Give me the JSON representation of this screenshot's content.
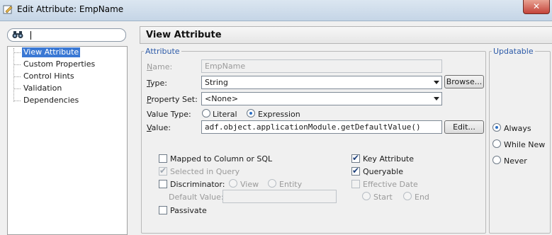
{
  "window": {
    "title": "Edit Attribute: EmpName",
    "close_glyph": "✕"
  },
  "nav": {
    "search_placeholder": "",
    "items": [
      {
        "label": "View Attribute",
        "selected": true
      },
      {
        "label": "Custom Properties"
      },
      {
        "label": "Control Hints"
      },
      {
        "label": "Validation"
      },
      {
        "label": "Dependencies"
      }
    ]
  },
  "main": {
    "title": "View Attribute"
  },
  "attribute": {
    "legend": "Attribute",
    "name_label": "Name:",
    "name_value": "EmpName",
    "type_label": "Type:",
    "type_value": "String",
    "browse_label": "Browse...",
    "property_set_label": "Property Set:",
    "property_set_value": "<None>",
    "value_type_label": "Value Type:",
    "value_type_options": {
      "literal": "Literal",
      "expression": "Expression",
      "selected": "Expression"
    },
    "value_label": "Value:",
    "value_value": "adf.object.applicationModule.getDefaultValue()",
    "edit_label": "Edit...",
    "mapped_label": "Mapped to Column or SQL",
    "mapped_checked": false,
    "selected_in_query_label": "Selected in Query",
    "selected_in_query_checked": true,
    "discriminator_label": "Discriminator:",
    "discriminator_checked": false,
    "discriminator_options": {
      "view": "View",
      "entity": "Entity"
    },
    "default_value_label": "Default Value:",
    "default_value_value": "",
    "passivate_label": "Passivate",
    "passivate_checked": false,
    "key_attribute_label": "Key Attribute",
    "key_attribute_checked": true,
    "queryable_label": "Queryable",
    "queryable_checked": true,
    "effective_date_label": "Effective Date",
    "effective_date_checked": false,
    "effective_options": {
      "start": "Start",
      "end": "End"
    }
  },
  "updatable": {
    "legend": "Updatable",
    "options": [
      "Always",
      "While New",
      "Never"
    ],
    "selected": "Always"
  },
  "icons": {
    "search": "binoculars-icon",
    "tick": "✔"
  }
}
